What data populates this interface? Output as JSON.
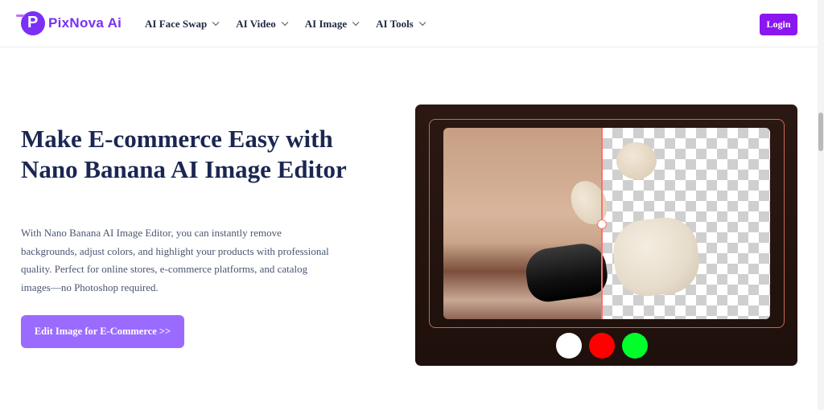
{
  "brand": {
    "name": "PixNova AI",
    "logo_text": "PixNova Ai",
    "accent": "#8a16f0"
  },
  "nav": {
    "items": [
      {
        "label": "AI Face Swap"
      },
      {
        "label": "AI Video"
      },
      {
        "label": "AI Image"
      },
      {
        "label": "AI Tools"
      }
    ],
    "login_label": "Login"
  },
  "hero": {
    "title": "Make E-commerce Easy with Nano Banana AI Image Editor",
    "description": "With Nano Banana AI Image Editor, you can instantly remove backgrounds, adjust colors, and highlight your products with professional quality. Perfect for online stores, e-commerce platforms, and catalog images—no Photoshop required.",
    "cta_label": "Edit Image for E-Commerce >>",
    "cta_color": "#9b6bff"
  },
  "preview": {
    "swatches": [
      {
        "color": "#ffffff"
      },
      {
        "color": "#ff0000"
      },
      {
        "color": "#00ff2a"
      }
    ]
  }
}
